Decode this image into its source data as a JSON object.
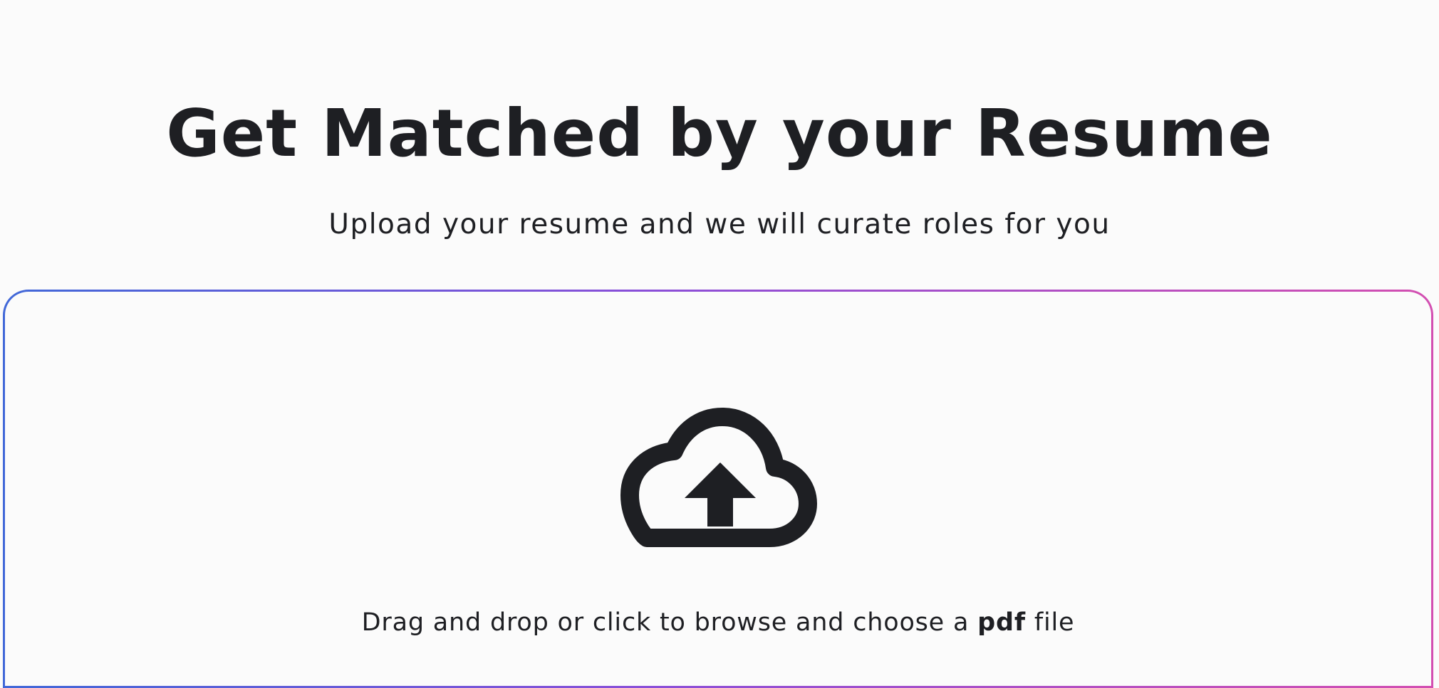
{
  "header": {
    "title": "Get Matched by your Resume",
    "subtitle": "Upload your resume and we will curate roles for you"
  },
  "dropzone": {
    "icon": "cloud-upload-icon",
    "instruction_prefix": "Drag and drop or click to browse and choose a",
    "file_type": "pdf",
    "instruction_suffix": "file",
    "border_gradient": [
      "#4168d8",
      "#8a4fd8",
      "#d34fb1"
    ]
  },
  "colors": {
    "text": "#1e1f23",
    "background": "#fbfbfb"
  }
}
